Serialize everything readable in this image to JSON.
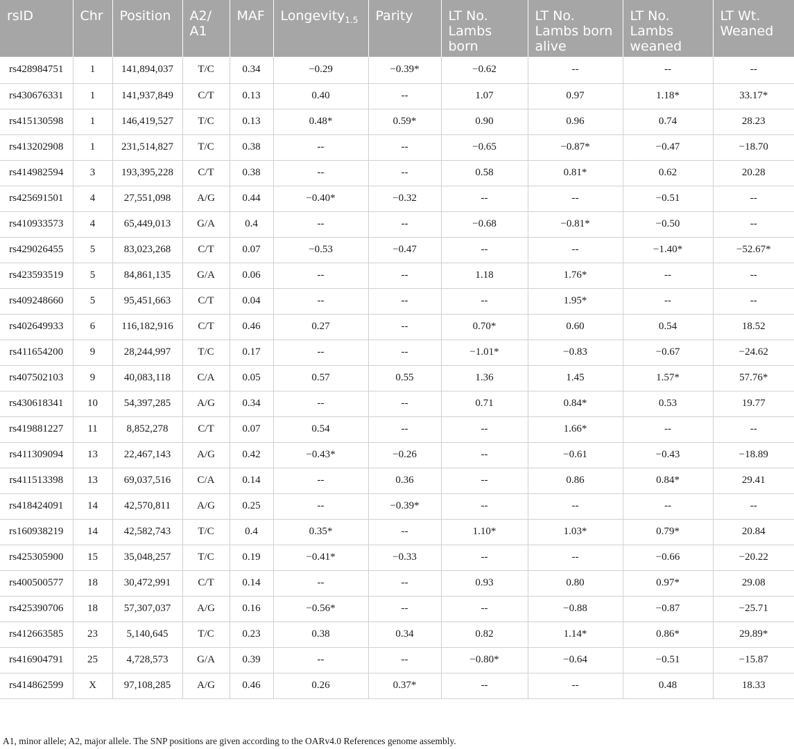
{
  "table": {
    "headers": [
      {
        "key": "rsid",
        "text": "rsID",
        "sub": ""
      },
      {
        "key": "chr",
        "text": "Chr",
        "sub": ""
      },
      {
        "key": "position",
        "text": "Position",
        "sub": ""
      },
      {
        "key": "alleles",
        "text": "A2/ A1",
        "sub": ""
      },
      {
        "key": "maf",
        "text": "MAF",
        "sub": ""
      },
      {
        "key": "longevity",
        "text": "Longevity",
        "sub": "1.5"
      },
      {
        "key": "parity",
        "text": "Parity",
        "sub": ""
      },
      {
        "key": "lt_born",
        "text": "LT No. Lambs born",
        "sub": ""
      },
      {
        "key": "lt_born_alive",
        "text": "LT No. Lambs born alive",
        "sub": ""
      },
      {
        "key": "lt_weaned",
        "text": "LT No. Lambs weaned",
        "sub": ""
      },
      {
        "key": "lt_wt_weaned",
        "text": "LT Wt. Weaned",
        "sub": ""
      }
    ],
    "rows": [
      [
        "rs428984751",
        "1",
        "141,894,037",
        "T/C",
        "0.34",
        "−0.29",
        "−0.39*",
        "−0.62",
        "--",
        "--",
        "--"
      ],
      [
        "rs430676331",
        "1",
        "141,937,849",
        "C/T",
        "0.13",
        "0.40",
        "--",
        "1.07",
        "0.97",
        "1.18*",
        "33.17*"
      ],
      [
        "rs415130598",
        "1",
        "146,419,527",
        "T/C",
        "0.13",
        "0.48*",
        "0.59*",
        "0.90",
        "0.96",
        "0.74",
        "28.23"
      ],
      [
        "rs413202908",
        "1",
        "231,514,827",
        "T/C",
        "0.38",
        "--",
        "--",
        "−0.65",
        "−0.87*",
        "−0.47",
        "−18.70"
      ],
      [
        "rs414982594",
        "3",
        "193,395,228",
        "C/T",
        "0.38",
        "--",
        "--",
        "0.58",
        "0.81*",
        "0.62",
        "20.28"
      ],
      [
        "rs425691501",
        "4",
        "27,551,098",
        "A/G",
        "0.44",
        "−0.40*",
        "−0.32",
        "--",
        "--",
        "−0.51",
        "--"
      ],
      [
        "rs410933573",
        "4",
        "65,449,013",
        "G/A",
        "0.4",
        "--",
        "--",
        "−0.68",
        "−0.81*",
        "−0.50",
        "--"
      ],
      [
        "rs429026455",
        "5",
        "83,023,268",
        "C/T",
        "0.07",
        "−0.53",
        "−0.47",
        "--",
        "--",
        "−1.40*",
        "−52.67*"
      ],
      [
        "rs423593519",
        "5",
        "84,861,135",
        "G/A",
        "0.06",
        "--",
        "--",
        "1.18",
        "1.76*",
        "--",
        "--"
      ],
      [
        "rs409248660",
        "5",
        "95,451,663",
        "C/T",
        "0.04",
        "--",
        "--",
        "--",
        "1.95*",
        "--",
        "--"
      ],
      [
        "rs402649933",
        "6",
        "116,182,916",
        "C/T",
        "0.46",
        "0.27",
        "--",
        "0.70*",
        "0.60",
        "0.54",
        "18.52"
      ],
      [
        "rs411654200",
        "9",
        "28,244,997",
        "T/C",
        "0.17",
        "--",
        "--",
        "−1.01*",
        "−0.83",
        "−0.67",
        "−24.62"
      ],
      [
        "rs407502103",
        "9",
        "40,083,118",
        "C/A",
        "0.05",
        "0.57",
        "0.55",
        "1.36",
        "1.45",
        "1.57*",
        "57.76*"
      ],
      [
        "rs430618341",
        "10",
        "54,397,285",
        "A/G",
        "0.34",
        "--",
        "--",
        "0.71",
        "0.84*",
        "0.53",
        "19.77"
      ],
      [
        "rs419881227",
        "11",
        "8,852,278",
        "C/T",
        "0.07",
        "0.54",
        "--",
        "--",
        "1.66*",
        "--",
        "--"
      ],
      [
        "rs411309094",
        "13",
        "22,467,143",
        "A/G",
        "0.42",
        "−0.43*",
        "−0.26",
        "--",
        "−0.61",
        "−0.43",
        "−18.89"
      ],
      [
        "rs411513398",
        "13",
        "69,037,516",
        "C/A",
        "0.14",
        "--",
        "0.36",
        "--",
        "0.86",
        "0.84*",
        "29.41"
      ],
      [
        "rs418424091",
        "14",
        "42,570,811",
        "A/G",
        "0.25",
        "--",
        "−0.39*",
        "--",
        "--",
        "--",
        "--"
      ],
      [
        "rs160938219",
        "14",
        "42,582,743",
        "T/C",
        "0.4",
        "0.35*",
        "--",
        "1.10*",
        "1.03*",
        "0.79*",
        "20.84"
      ],
      [
        "rs425305900",
        "15",
        "35,048,257",
        "T/C",
        "0.19",
        "−0.41*",
        "−0.33",
        "--",
        "--",
        "−0.66",
        "−20.22"
      ],
      [
        "rs400500577",
        "18",
        "30,472,991",
        "C/T",
        "0.14",
        "--",
        "--",
        "0.93",
        "0.80",
        "0.97*",
        "29.08"
      ],
      [
        "rs425390706",
        "18",
        "57,307,037",
        "A/G",
        "0.16",
        "−0.56*",
        "--",
        "--",
        "−0.88",
        "−0.87",
        "−25.71"
      ],
      [
        "rs412663585",
        "23",
        "5,140,645",
        "T/C",
        "0.23",
        "0.38",
        "0.34",
        "0.82",
        "1.14*",
        "0.86*",
        "29.89*"
      ],
      [
        "rs416904791",
        "25",
        "4,728,573",
        "G/A",
        "0.39",
        "--",
        "--",
        "−0.80*",
        "−0.64",
        "−0.51",
        "−15.87"
      ],
      [
        "rs414862599",
        "X",
        "97,108,285",
        "A/G",
        "0.46",
        "0.26",
        "0.37*",
        "--",
        "--",
        "0.48",
        "18.33"
      ]
    ]
  },
  "footnote": "A1, minor allele; A2, major allele. The SNP positions are given according to the OARv4.0 References genome assembly."
}
